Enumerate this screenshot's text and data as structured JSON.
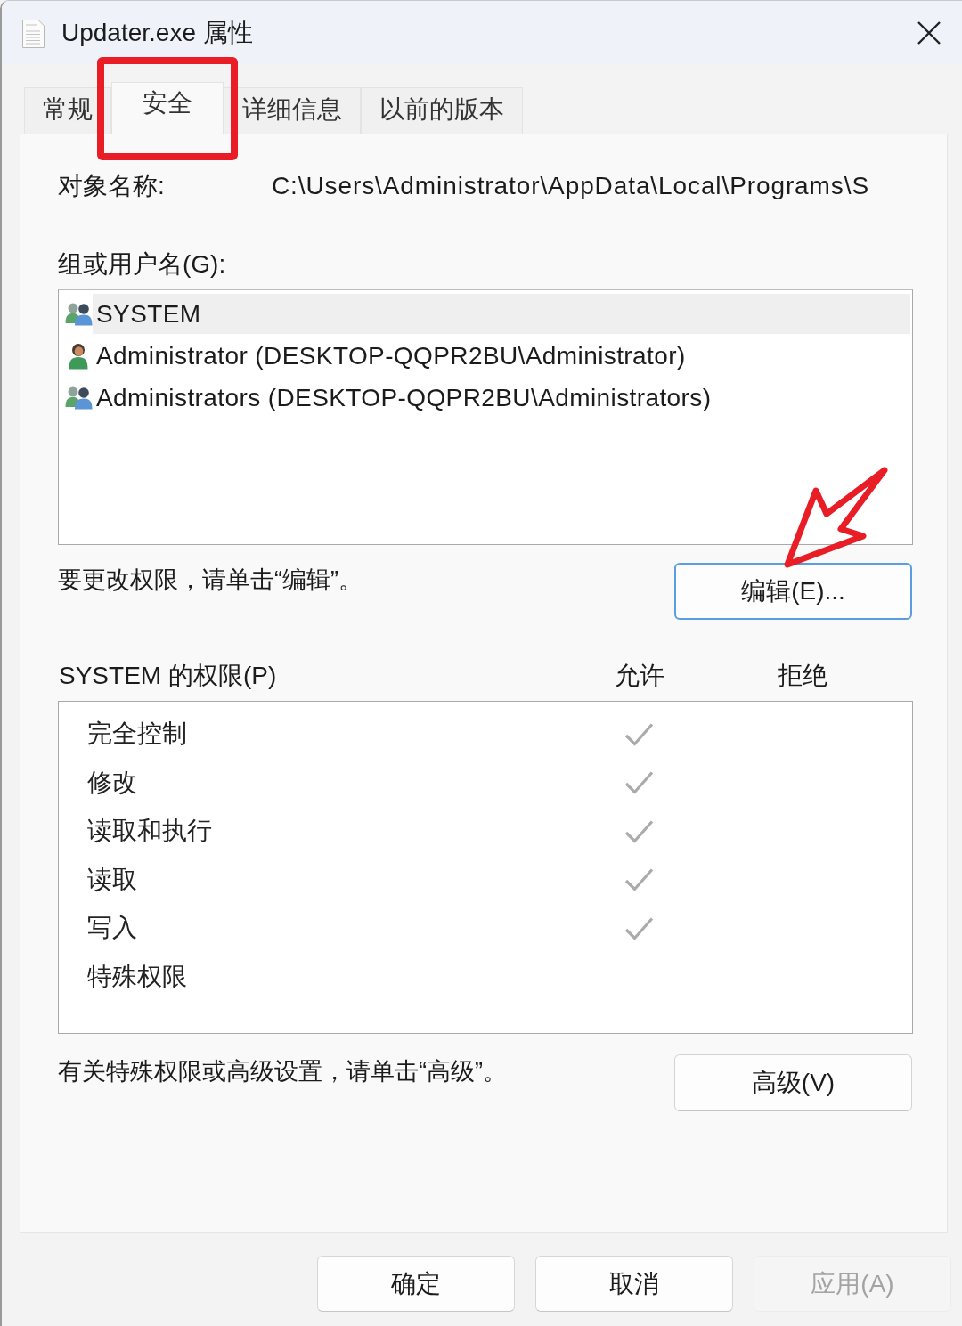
{
  "window": {
    "title": "Updater.exe 属性"
  },
  "tabs": [
    {
      "label": "常规",
      "selected": false,
      "highlighted": false
    },
    {
      "label": "安全",
      "selected": true,
      "highlighted": true
    },
    {
      "label": "详细信息",
      "selected": false,
      "highlighted": false
    },
    {
      "label": "以前的版本",
      "selected": false,
      "highlighted": false
    }
  ],
  "object_name": {
    "label": "对象名称:",
    "value": "C:\\Users\\Administrator\\AppData\\Local\\Programs\\S"
  },
  "groups": {
    "label": "组或用户名(G):",
    "items": [
      {
        "name": "SYSTEM",
        "kind": "group",
        "selected": true
      },
      {
        "name": "Administrator (DESKTOP-QQPR2BU\\Administrator)",
        "kind": "user",
        "selected": false
      },
      {
        "name": "Administrators (DESKTOP-QQPR2BU\\Administrators)",
        "kind": "group",
        "selected": false
      }
    ]
  },
  "edit": {
    "hint": "要更改权限，请单击“编辑”。",
    "button": {
      "label": "编辑(E)...",
      "focused": true,
      "arrow": true
    }
  },
  "permissions": {
    "title": "SYSTEM 的权限(P)",
    "columns": [
      "允许",
      "拒绝"
    ],
    "rows": [
      {
        "name": "完全控制",
        "allow": true,
        "deny": false
      },
      {
        "name": "修改",
        "allow": true,
        "deny": false
      },
      {
        "name": "读取和执行",
        "allow": true,
        "deny": false
      },
      {
        "name": "读取",
        "allow": true,
        "deny": false
      },
      {
        "name": "写入",
        "allow": true,
        "deny": false
      },
      {
        "name": "特殊权限",
        "allow": false,
        "deny": false
      }
    ]
  },
  "advanced": {
    "hint": "有关特殊权限或高级设置，请单击“高级”。",
    "button": {
      "label": "高级(V)",
      "focused": false
    }
  },
  "buttons": {
    "ok": {
      "label": "确定",
      "disabled": false
    },
    "cancel": {
      "label": "取消",
      "disabled": false
    },
    "apply": {
      "label": "应用(A)",
      "disabled": true
    }
  }
}
